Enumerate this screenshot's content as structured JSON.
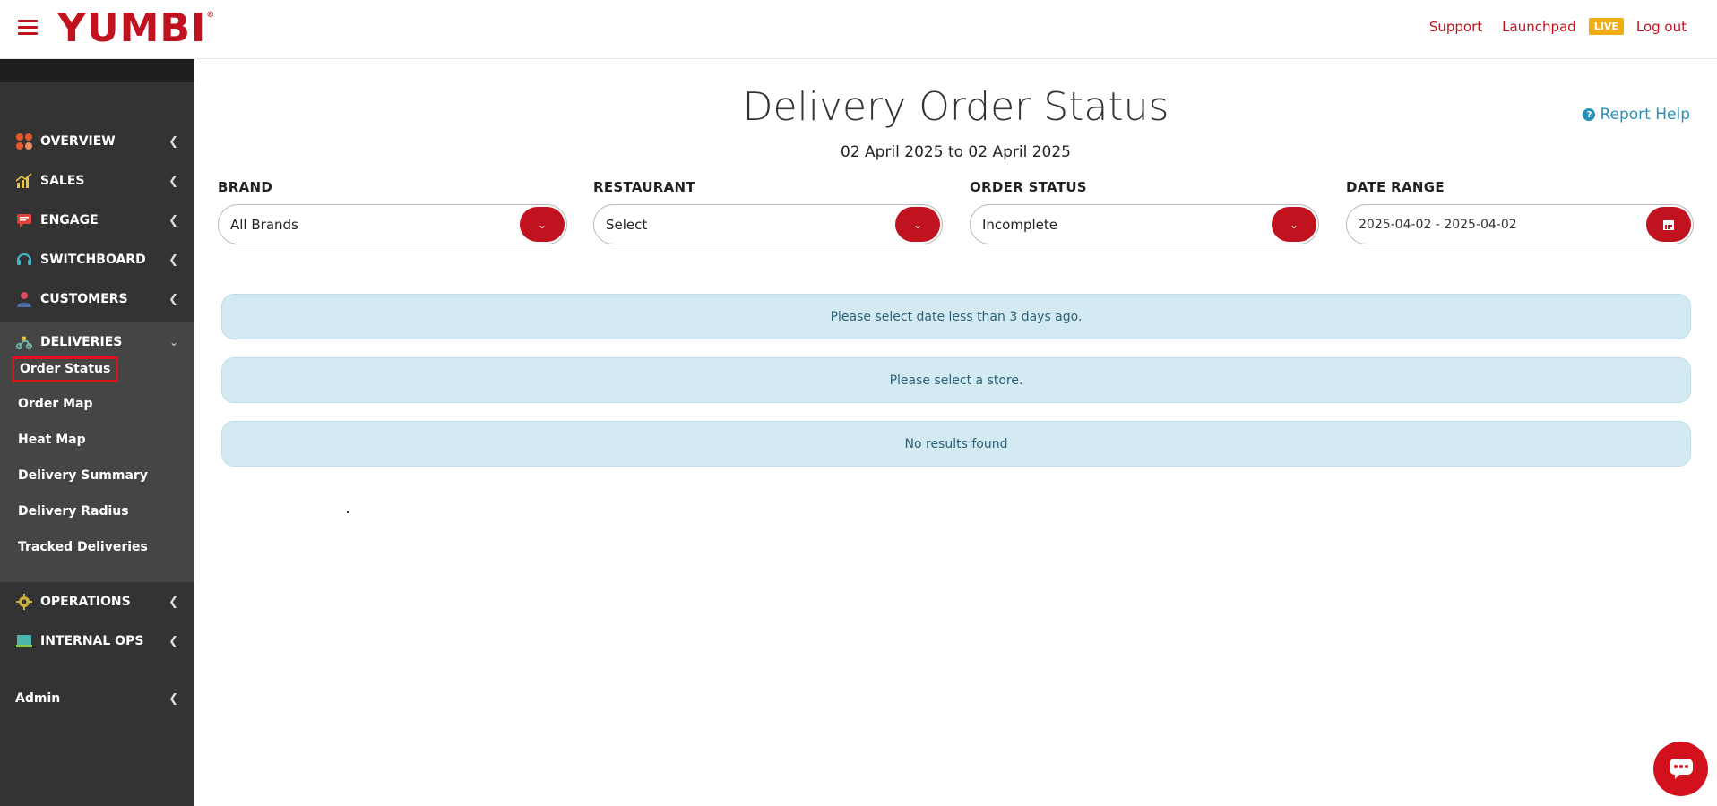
{
  "header": {
    "logo": "YUMBI",
    "logo_mark": "®",
    "links": {
      "support": "Support",
      "launchpad": "Launchpad",
      "live_badge": "LIVE",
      "logout": "Log out"
    }
  },
  "sidebar": {
    "items": [
      {
        "label": "OVERVIEW",
        "icon": "overview-icon"
      },
      {
        "label": "SALES",
        "icon": "sales-chart-icon"
      },
      {
        "label": "ENGAGE",
        "icon": "chat-icon"
      },
      {
        "label": "SWITCHBOARD",
        "icon": "headset-icon"
      },
      {
        "label": "CUSTOMERS",
        "icon": "user-icon"
      },
      {
        "label": "DELIVERIES",
        "icon": "scooter-icon"
      },
      {
        "label": "OPERATIONS",
        "icon": "gear-icon"
      },
      {
        "label": "INTERNAL OPS",
        "icon": "monitor-icon"
      },
      {
        "label": "Admin",
        "icon": ""
      }
    ],
    "deliveries_sub": [
      "Order Status",
      "Order Map",
      "Heat Map",
      "Delivery Summary",
      "Delivery Radius",
      "Tracked Deliveries"
    ],
    "active_sub": "Order Status"
  },
  "main": {
    "title": "Delivery Order Status",
    "date_range_text": "02 April 2025 to 02 April 2025",
    "report_help": "Report Help",
    "filters": {
      "brand": {
        "label": "BRAND",
        "value": "All Brands"
      },
      "restaurant": {
        "label": "RESTAURANT",
        "value": "Select"
      },
      "order_status": {
        "label": "ORDER STATUS",
        "value": "Incomplete"
      },
      "date_range": {
        "label": "DATE RANGE",
        "value": "2025-04-02 - 2025-04-02"
      }
    },
    "alerts": [
      "Please select date less than 3 days ago.",
      "Please select a store.",
      "No results found"
    ]
  },
  "colors": {
    "brand_red": "#c1121f",
    "sidebar_bg": "#333333",
    "alert_bg": "#d4eaf3",
    "link_blue": "#2a8fb8",
    "live_badge": "#f0ad12"
  }
}
